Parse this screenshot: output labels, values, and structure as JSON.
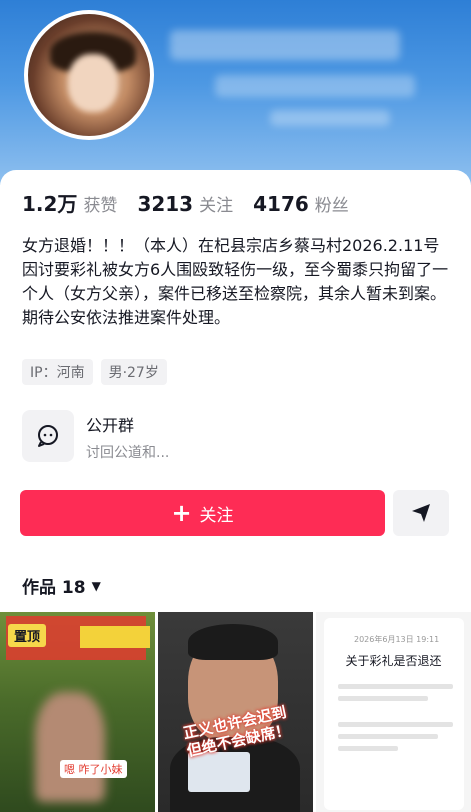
{
  "profile": {
    "stats": [
      {
        "num": "1.2万",
        "label": "获赞"
      },
      {
        "num": "3213",
        "label": "关注"
      },
      {
        "num": "4176",
        "label": "粉丝"
      }
    ],
    "bio": "女方退婚！！！（本人）在杞县宗店乡蔡马村2026.2.11号因讨要彩礼被女方6人围殴致轻伤一级，至今蜀黍只拘留了一个人（女方父亲），案件已移送至检察院，其余人暂未到案。期待公安依法推进案件处理。",
    "tags": [
      "IP：河南",
      "男·27岁"
    ]
  },
  "group": {
    "title": "公开群",
    "subtitle": "讨回公道和..."
  },
  "actions": {
    "follow_label": "关注",
    "follow_plus": "+"
  },
  "works": {
    "tab_label": "作品 18",
    "thumbs": [
      {
        "badge": "置顶",
        "caption": "嗯 咋了小妹"
      },
      {
        "overlay": "正义也许会迟到 但绝不会缺席！"
      },
      {
        "date": "2026年6月13日 19:11",
        "title": "关于彩礼是否退还"
      }
    ]
  },
  "colors": {
    "accent": "#fe2c55",
    "banner": "#4d98e3"
  }
}
